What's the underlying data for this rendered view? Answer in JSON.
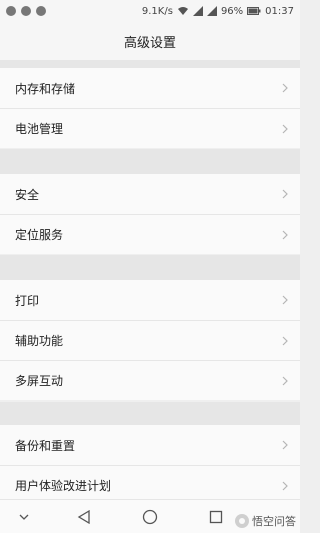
{
  "status_bar": {
    "network_speed": "9.1K/s",
    "battery_percent": "96%",
    "time": "01:37"
  },
  "header": {
    "title": "高级设置"
  },
  "groups": [
    {
      "items": [
        {
          "label": "内存和存储"
        },
        {
          "label": "电池管理"
        }
      ]
    },
    {
      "items": [
        {
          "label": "安全"
        },
        {
          "label": "定位服务"
        }
      ]
    },
    {
      "items": [
        {
          "label": "打印"
        },
        {
          "label": "辅助功能"
        },
        {
          "label": "多屏互动"
        }
      ]
    },
    {
      "items": [
        {
          "label": "备份和重置"
        },
        {
          "label": "用户体验改进计划"
        }
      ]
    }
  ],
  "watermark": {
    "text": "悟空问答"
  }
}
